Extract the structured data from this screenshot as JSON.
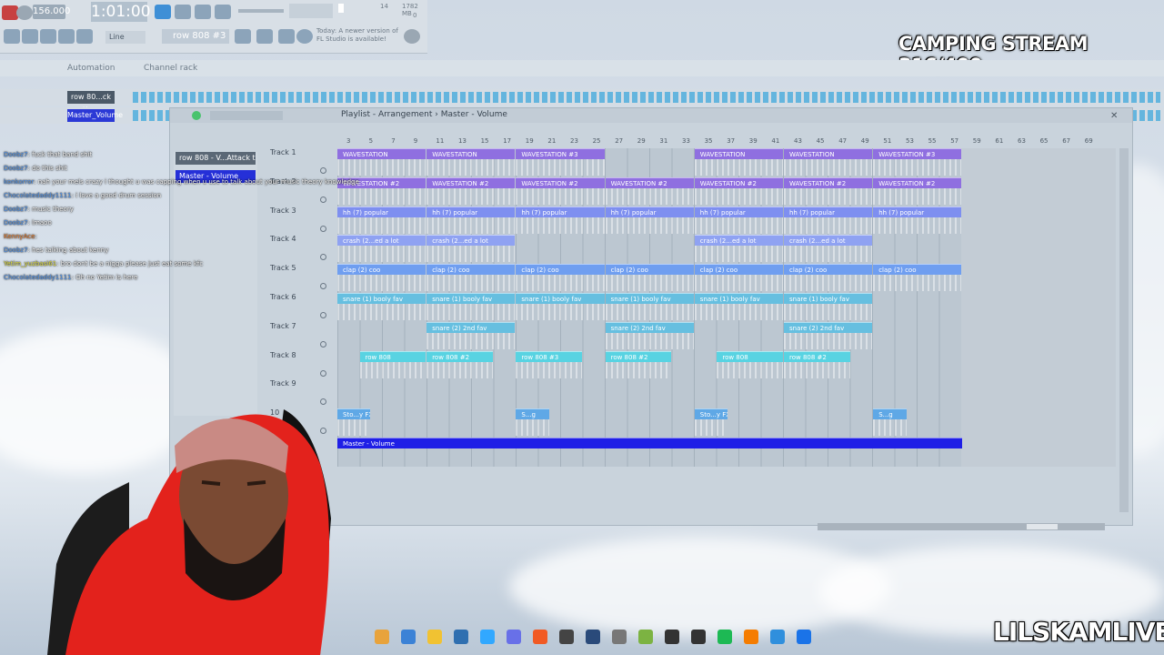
{
  "toolbar": {
    "tempo": "156.000",
    "time": "1:01:00",
    "snap": "Line",
    "pattern": "row 808 #3",
    "update_notice": "Today: A newer version of FL Studio is available!",
    "cpu_value": "14",
    "ram_value": "1782 MB",
    "voices": "0"
  },
  "stream_title": "CAMPING STREAM 316/400",
  "brand": "LILSKAMLIVE",
  "channel_rack": {
    "tab_automation": "Automation",
    "tab_channel_rack": "Channel rack",
    "channels": [
      {
        "label": "row 80...ck time"
      },
      {
        "label": "Master_Volume"
      }
    ]
  },
  "chat": [
    {
      "user": "",
      "msg": "..."
    },
    {
      "user": "Doobz7",
      "msg": "fuck that band shit"
    },
    {
      "user": "Doobz7",
      "msg": "do this shit"
    },
    {
      "user": "konkorror",
      "msg": "nah your mels crazy i thought u was capping when u use to talk about your music theory knowledge"
    },
    {
      "user": "Chocolatedaddy1111",
      "msg": "i love a good drum session"
    },
    {
      "user": "Doobz7",
      "msg": "music theory"
    },
    {
      "user": "Doobz7",
      "msg": "lmaoo"
    },
    {
      "user": "KennyAce",
      "msg": ""
    },
    {
      "user": "Doobz7",
      "msg": "hes talking about kenny"
    },
    {
      "user": "Yetim_yuzbasi61",
      "msg": "bro dont be a nigga please just eat some kfc"
    },
    {
      "user": "Chocolatedaddy1111",
      "msg": "Oh no Yetim is here"
    }
  ],
  "playlist": {
    "title": "Playlist - Arrangement",
    "breadcrumb_sep": "›",
    "current": "Master - Volume",
    "picker": [
      {
        "label": "row 808 - V...Attack time"
      },
      {
        "label": "Master - Volume"
      }
    ],
    "tracks": [
      "Track 1",
      "Track 2",
      "Track 3",
      "Track 4",
      "Track 5",
      "Track 6",
      "Track 7",
      "Track 8",
      "Track 9",
      "10"
    ],
    "ruler": [
      "3",
      "5",
      "7",
      "9",
      "11",
      "13",
      "15",
      "17",
      "19",
      "21",
      "23",
      "25",
      "27",
      "29",
      "31",
      "33",
      "35",
      "37",
      "39",
      "41",
      "43",
      "45",
      "47",
      "49",
      "51",
      "53",
      "55",
      "57",
      "59",
      "61",
      "63",
      "65",
      "67",
      "69"
    ],
    "clips": {
      "wav": [
        "WAVESTATION",
        "WAVESTATION",
        "WAVESTATION #3",
        "WAVESTATION",
        "WAVESTATION",
        "WAVESTATION #3"
      ],
      "wav2": [
        "WAVESTATION #2",
        "WAVESTATION #2",
        "WAVESTATION #2",
        "WAVESTATION #2",
        "WAVESTATION #2",
        "WAVESTATION #2",
        "WAVESTATION #2"
      ],
      "hh": [
        "hh (7) popular",
        "hh (7) popular",
        "hh (7) popular",
        "hh (7) popular",
        "hh (7) popular",
        "hh (7) popular",
        "hh (7) popular"
      ],
      "crash": [
        "crash (2...ed a lot",
        "crash (2...ed a lot",
        "crash (2...ed a lot",
        "crash (2...ed a lot"
      ],
      "clap": [
        "clap (2) coo",
        "clap (2) coo",
        "clap (2) coo",
        "clap (2) coo",
        "clap (2) coo",
        "clap (2) coo",
        "clap (2) coo"
      ],
      "snare": [
        "snare (1) booly fav",
        "snare (1) booly fav",
        "snare (1) booly fav",
        "snare (1) booly fav",
        "snare (1) booly fav",
        "snare (1) booly fav"
      ],
      "snare2": [
        "snare (2) 2nd fav",
        "snare (2) 2nd fav",
        "snare (2) 2nd fav"
      ],
      "row808": [
        "row 808",
        "row 808 #2",
        "row 808 #3",
        "row 808 #2",
        "row 808",
        "row 808 #2"
      ],
      "fx": [
        "Sto...y FX",
        "S...g",
        "Sto...y FX",
        "S...g"
      ],
      "master": "Master - Volume"
    }
  },
  "colors": {
    "wav": "#8f6fe0",
    "hh": "#7e8ff0",
    "clap": "#6f9ef0",
    "snare": "#66bfe0",
    "row808": "#58d3e2",
    "master": "#1f1fe6"
  }
}
